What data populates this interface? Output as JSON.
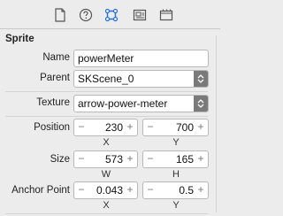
{
  "toolbar": {
    "icons": [
      "file-inspector-icon",
      "quick-help-icon",
      "attributes-inspector-icon",
      "size-inspector-icon",
      "media-library-icon"
    ]
  },
  "section": {
    "title": "Sprite"
  },
  "name": {
    "label": "Name",
    "value": "powerMeter"
  },
  "parent": {
    "label": "Parent",
    "value": "SKScene_0"
  },
  "texture": {
    "label": "Texture",
    "value": "arrow-power-meter"
  },
  "position": {
    "label": "Position",
    "x": {
      "value": "230",
      "sublabel": "X"
    },
    "y": {
      "value": "700",
      "sublabel": "Y"
    }
  },
  "size": {
    "label": "Size",
    "w": {
      "value": "573",
      "sublabel": "W"
    },
    "h": {
      "value": "165",
      "sublabel": "H"
    }
  },
  "anchor": {
    "label": "Anchor Point",
    "x": {
      "value": "0.043",
      "sublabel": "X"
    },
    "y": {
      "value": "0.5",
      "sublabel": "Y"
    }
  },
  "stepper": {
    "minus": "−",
    "plus": "+"
  },
  "colors": {
    "accent": "#1d6df2",
    "background": "#ececec",
    "field_border": "#b9b9b9"
  }
}
